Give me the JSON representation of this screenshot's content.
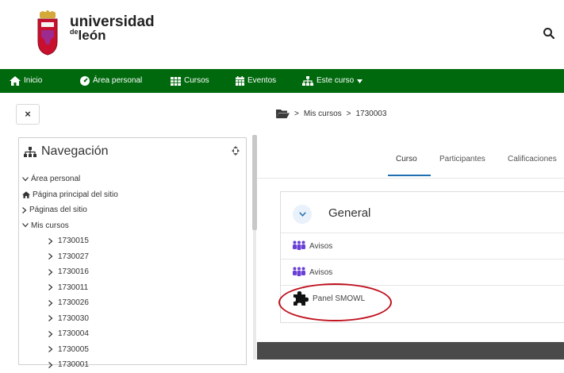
{
  "brand": {
    "line1": "universidad",
    "line2_prefix": "de",
    "line2": "león"
  },
  "navbar": {
    "home": "Inicio",
    "dashboard": "Área personal",
    "courses": "Cursos",
    "events": "Eventos",
    "this_course": "Este curso"
  },
  "close_label": "×",
  "breadcrumb": {
    "item1": "Mis cursos",
    "item2": "1730003"
  },
  "navigation": {
    "title": "Navegación",
    "items": {
      "dashboard": "Área personal",
      "site_home": "Página principal del sitio",
      "site_pages": "Páginas del sitio",
      "my_courses": "Mis cursos"
    },
    "courses": [
      "1730015",
      "1730027",
      "1730016",
      "1730011",
      "1730026",
      "1730030",
      "1730004",
      "1730005",
      "1730001"
    ]
  },
  "tabs": {
    "course": "Curso",
    "participants": "Participantes",
    "grades": "Calificaciones"
  },
  "section": {
    "title": "General"
  },
  "activities": [
    "Avisos",
    "Avisos",
    "Panel SMOWL"
  ],
  "colors": {
    "navbar": "#00690d",
    "accent": "#1f6fb2",
    "highlight": "#c0121f"
  }
}
